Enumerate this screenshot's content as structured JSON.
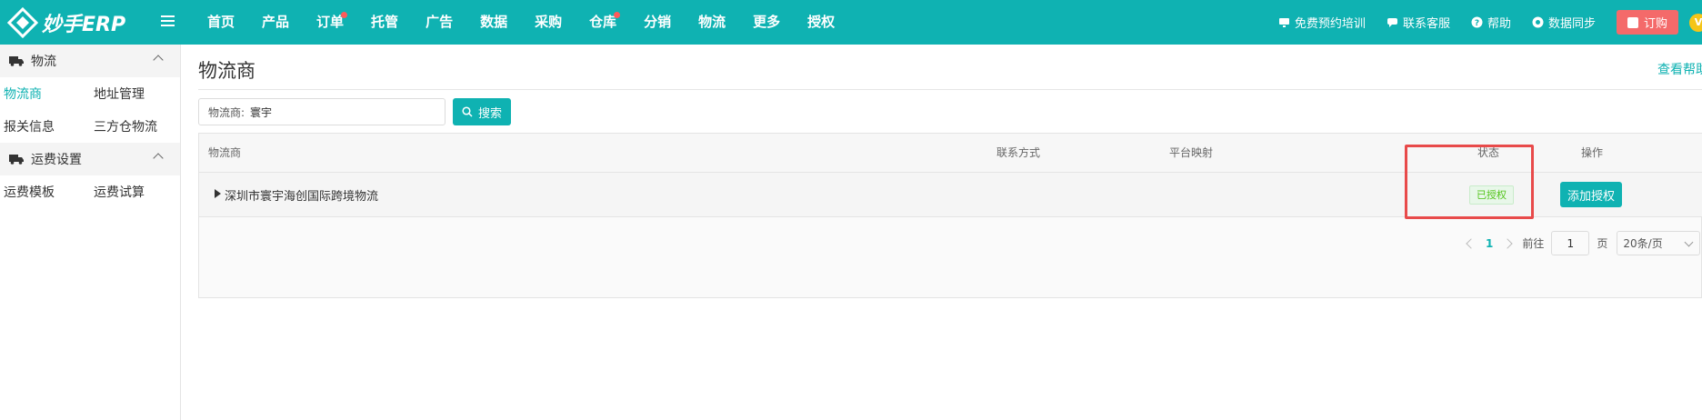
{
  "app": {
    "brand": "妙手ERP"
  },
  "colors": {
    "accent": "#0fb2b2",
    "danger": "#f46a6a",
    "success": "#52c41a",
    "highlight": "#e84a4a"
  },
  "nav": {
    "items": [
      {
        "label": "首页",
        "dot": false
      },
      {
        "label": "产品",
        "dot": false
      },
      {
        "label": "订单",
        "dot": true
      },
      {
        "label": "托管",
        "dot": false
      },
      {
        "label": "广告",
        "dot": false
      },
      {
        "label": "数据",
        "dot": false
      },
      {
        "label": "采购",
        "dot": false
      },
      {
        "label": "仓库",
        "dot": true
      },
      {
        "label": "分销",
        "dot": false
      },
      {
        "label": "物流",
        "dot": false
      },
      {
        "label": "更多",
        "dot": false
      },
      {
        "label": "授权",
        "dot": false
      }
    ],
    "utils": [
      {
        "label": "免费预约培训",
        "icon": "monitor-icon"
      },
      {
        "label": "联系客服",
        "icon": "chat-icon"
      },
      {
        "label": "帮助",
        "icon": "question-icon"
      },
      {
        "label": "数据同步",
        "icon": "sync-icon"
      }
    ],
    "order_label": "订购",
    "vip_label": "V"
  },
  "sidebar": {
    "groups": [
      {
        "title": "物流",
        "links": [
          [
            "物流商",
            "地址管理"
          ],
          [
            "报关信息",
            "三方仓物流"
          ]
        ]
      },
      {
        "title": "运费设置",
        "links": [
          [
            "运费模板",
            "运费试算"
          ]
        ]
      }
    ]
  },
  "main": {
    "title": "物流商",
    "help": "查看帮助",
    "search": {
      "label": "物流商:",
      "value": "寰宇",
      "button": "搜索"
    },
    "table": {
      "headers": {
        "carrier": "物流商",
        "contact": "联系方式",
        "platform": "平台映射",
        "status": "状态",
        "actions": "操作"
      },
      "rows": [
        {
          "name": "深圳市寰宇海创国际跨境物流",
          "status": "已授权",
          "action": "添加授权"
        }
      ]
    },
    "pagination": {
      "current": "1",
      "goto_label": "前往",
      "goto_value": "1",
      "page_label": "页",
      "page_size": "20条/页"
    }
  }
}
